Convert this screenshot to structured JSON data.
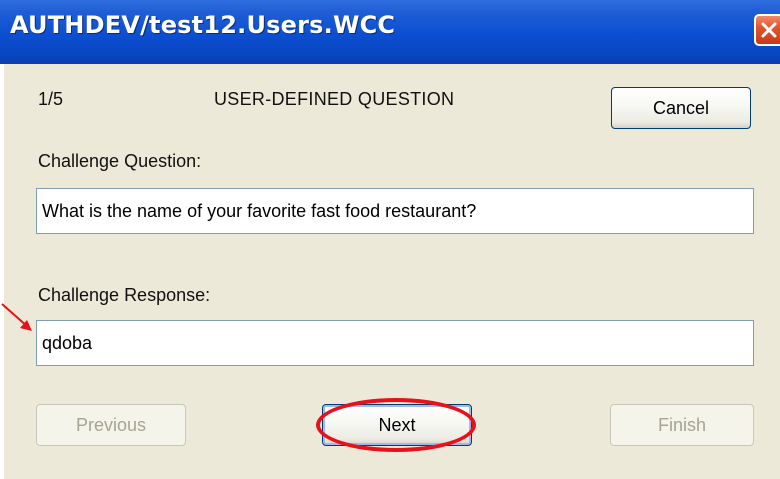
{
  "window": {
    "title": "AUTHDEV/test12.Users.WCC"
  },
  "wizard": {
    "step": "1/5",
    "heading": "USER-DEFINED QUESTION",
    "cancel_label": "Cancel"
  },
  "question": {
    "label": "Challenge Question:",
    "value": "What is the name of your favorite fast food restaurant?"
  },
  "response": {
    "label": "Challenge Response:",
    "value": "qdoba"
  },
  "nav": {
    "previous_label": "Previous",
    "next_label": "Next",
    "finish_label": "Finish"
  },
  "icons": {
    "close": "close-icon"
  },
  "colors": {
    "titlebar": "#0b4fd0",
    "dialog_background": "#ede9d8",
    "annotation": "#e8101a"
  }
}
